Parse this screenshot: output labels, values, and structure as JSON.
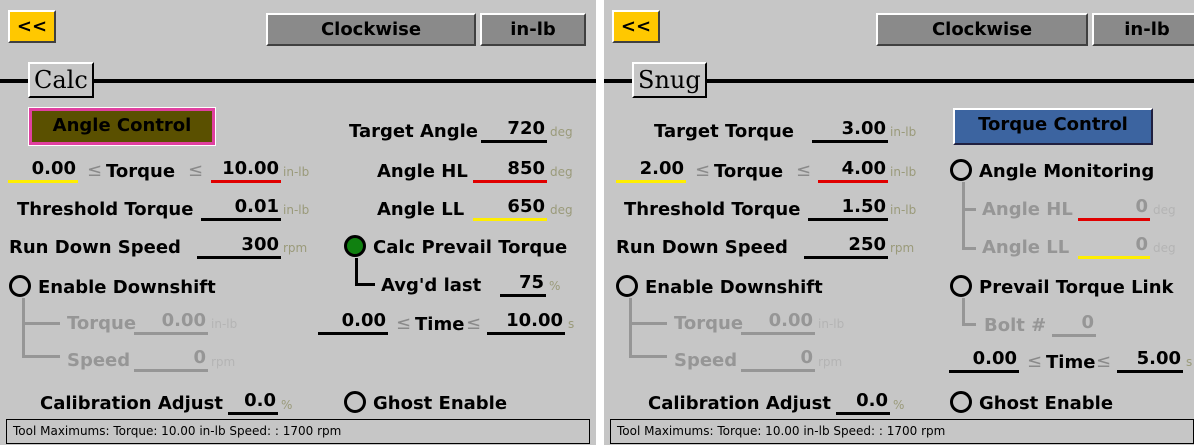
{
  "left": {
    "back_label": "<<",
    "direction_label": "Clockwise",
    "unit_label": "in-lb",
    "tab_label": "Calc",
    "mode_button": "Angle Control",
    "target_angle_label": "Target Angle",
    "target_angle_value": "720",
    "target_angle_unit": "deg",
    "torque_min": "0.00",
    "le": "≤",
    "torque_label": "Torque",
    "torque_max": "10.00",
    "torque_unit": "in-lb",
    "angle_hl_label": "Angle HL",
    "angle_hl_value": "850",
    "angle_hl_unit": "deg",
    "threshold_label": "Threshold Torque",
    "threshold_value": "0.01",
    "threshold_unit": "in-lb",
    "angle_ll_label": "Angle LL",
    "angle_ll_value": "650",
    "angle_ll_unit": "deg",
    "rundown_label": "Run Down Speed",
    "rundown_value": "300",
    "rundown_unit": "rpm",
    "calc_prevail_label": "Calc Prevail Torque",
    "downshift_label": "Enable Downshift",
    "avgd_label": "Avg'd last",
    "avgd_value": "75",
    "avgd_unit": "%",
    "ds_torque_label": "Torque",
    "ds_torque_value": "0.00",
    "ds_torque_unit": "in-lb",
    "time_min": "0.00",
    "time_label": "Time",
    "time_max": "10.00",
    "time_unit": "s",
    "ds_speed_label": "Speed",
    "ds_speed_value": "0",
    "ds_speed_unit": "rpm",
    "calib_label": "Calibration Adjust",
    "calib_value": "0.0",
    "calib_unit": "%",
    "ghost_label": "Ghost Enable",
    "status": "Tool Maximums:  Torque: 10.00  in-lb Speed: : 1700  rpm"
  },
  "right": {
    "back_label": "<<",
    "direction_label": "Clockwise",
    "unit_label": "in-lb",
    "tab_label": "Snug",
    "target_torque_label": "Target Torque",
    "target_torque_value": "3.00",
    "target_torque_unit": "in-lb",
    "mode_button": "Torque Control",
    "torque_min": "2.00",
    "le": "≤",
    "torque_label": "Torque",
    "torque_max": "4.00",
    "torque_unit": "in-lb",
    "angle_monitoring_label": "Angle Monitoring",
    "threshold_label": "Threshold Torque",
    "threshold_value": "1.50",
    "threshold_unit": "in-lb",
    "angle_hl_label": "Angle HL",
    "angle_hl_value": "0",
    "angle_hl_unit": "deg",
    "rundown_label": "Run Down Speed",
    "rundown_value": "250",
    "rundown_unit": "rpm",
    "angle_ll_label": "Angle LL",
    "angle_ll_value": "0",
    "angle_ll_unit": "deg",
    "downshift_label": "Enable Downshift",
    "prevail_link_label": "Prevail Torque Link",
    "ds_torque_label": "Torque",
    "ds_torque_value": "0.00",
    "ds_torque_unit": "in-lb",
    "bolt_label": "Bolt #",
    "bolt_value": "0",
    "ds_speed_label": "Speed",
    "ds_speed_value": "0",
    "ds_speed_unit": "rpm",
    "time_min": "0.00",
    "time_label": "Time",
    "time_max": "5.00",
    "time_unit": "s",
    "calib_label": "Calibration Adjust",
    "calib_value": "0.0",
    "calib_unit": "%",
    "ghost_label": "Ghost Enable",
    "status": "Tool Maximums:  Torque: 10.00  in-lb Speed: : 1700  rpm"
  },
  "colors": {
    "background": "#c6c6c6",
    "back_button": "#ffc800",
    "angle_control_bg": "#5a5000",
    "angle_control_border": "#e040a0",
    "torque_control_bg": "#3c64a0",
    "limit_high": "#e00000",
    "limit_low": "#ffee00",
    "radio_on": "#108010"
  }
}
